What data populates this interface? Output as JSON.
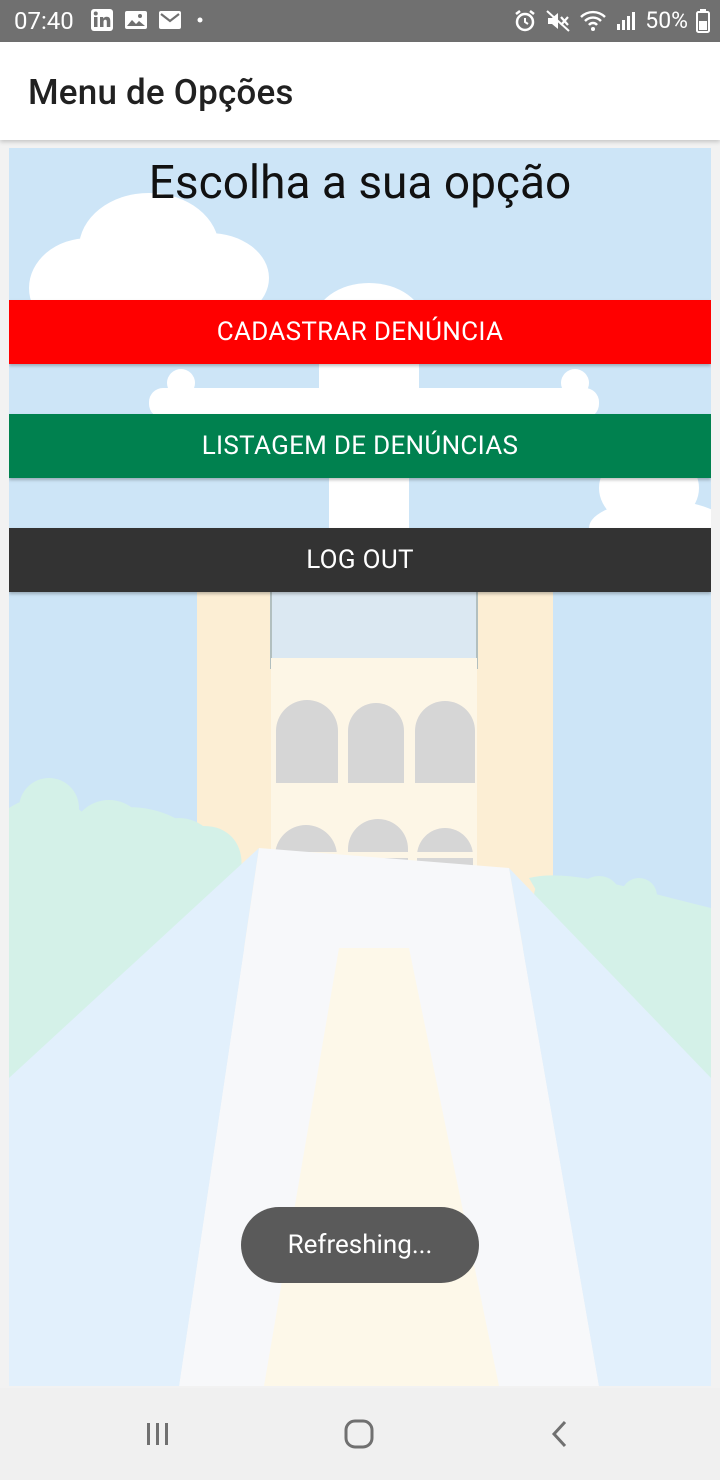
{
  "status_bar": {
    "time": "07:40",
    "battery": "50%",
    "icons": [
      "linkedin-icon",
      "gallery-icon",
      "email-icon",
      "dot-icon",
      "alarm-icon",
      "mute-icon",
      "wifi-icon",
      "signal-icon",
      "battery-icon"
    ]
  },
  "app_bar": {
    "title": "Menu de Opções"
  },
  "main": {
    "heading": "Escolha a sua opção",
    "buttons": {
      "cadastrar": "CADASTRAR DENÚNCIA",
      "listagem": "LISTAGEM DE DENÚNCIAS",
      "logout": "LOG OUT"
    },
    "colors": {
      "cadastrar": "#ff0000",
      "listagem": "#00814f",
      "logout": "#333333"
    }
  },
  "toast": {
    "text": "Refreshing..."
  },
  "nav_bar": {
    "icons": [
      "recent-apps-icon",
      "home-icon",
      "back-icon"
    ]
  }
}
